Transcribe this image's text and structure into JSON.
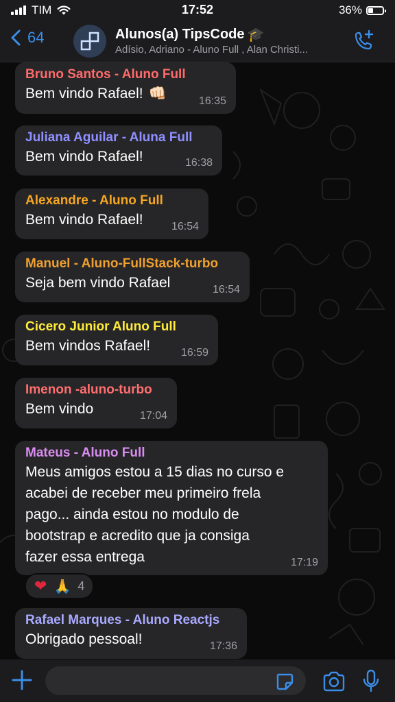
{
  "status_bar": {
    "carrier": "TIM",
    "time": "17:52",
    "battery": "36%",
    "battery_level": 0.36
  },
  "header": {
    "back_count": "64",
    "title": "Alunos(a) TipsCode",
    "title_emoji": "🎓",
    "subtitle": "Adísio, Adriano - Aluno Full , Alan Christi..."
  },
  "messages": [
    {
      "sender": "Bruno Santos  - Aluno Full",
      "sender_color": "#ff6b6b",
      "text": "Bem vindo Rafael!",
      "emoji": "👊🏻",
      "time": "16:35"
    },
    {
      "sender": "Juliana  Aguilar - Aluna Full",
      "sender_color": "#8f8fff",
      "text": "Bem vindo Rafael!",
      "time": "16:38"
    },
    {
      "sender": "Alexandre - Aluno Full",
      "sender_color": "#f5a623",
      "text": "Bem vindo Rafael!",
      "time": "16:54"
    },
    {
      "sender": "Manuel - Aluno-FullStack-turbo",
      "sender_color": "#f0a030",
      "text": "Seja bem vindo Rafael",
      "time": "16:54"
    },
    {
      "sender": "Cicero Junior Aluno Full",
      "sender_color": "#ffeb3b",
      "text": "Bem vindos Rafael!",
      "time": "16:59"
    },
    {
      "sender": "Imenon -aluno-turbo",
      "sender_color": "#ff6f6f",
      "text": "Bem vindo",
      "time": "17:04"
    },
    {
      "sender": "Mateus  - Aluno Full",
      "sender_color": "#d98cf0",
      "text": "Meus amigos estou a 15 dias no curso e\nacabei de receber meu primeiro frela\npago... ainda estou no modulo de\nbootstrap e acredito que ja consiga\nfazer essa entrega",
      "time": "17:19"
    },
    {
      "sender": "Rafael Marques - Aluno Reactjs",
      "sender_color": "#a9a9ff",
      "text": "Obrigado pessoal!",
      "time": "17:36"
    }
  ],
  "reactions": {
    "heart": "❤",
    "pray": "🙏",
    "count": "4"
  },
  "icons": [
    "signal-icon",
    "wifi-icon",
    "battery-icon",
    "back-chevron-icon",
    "group-avatar-icon",
    "call-add-icon",
    "plus-icon",
    "sticker-icon",
    "camera-icon",
    "mic-icon"
  ],
  "colors": {
    "accent": "#3b8ee8",
    "bubble": "#262628",
    "bar": "#1c1c1e"
  }
}
